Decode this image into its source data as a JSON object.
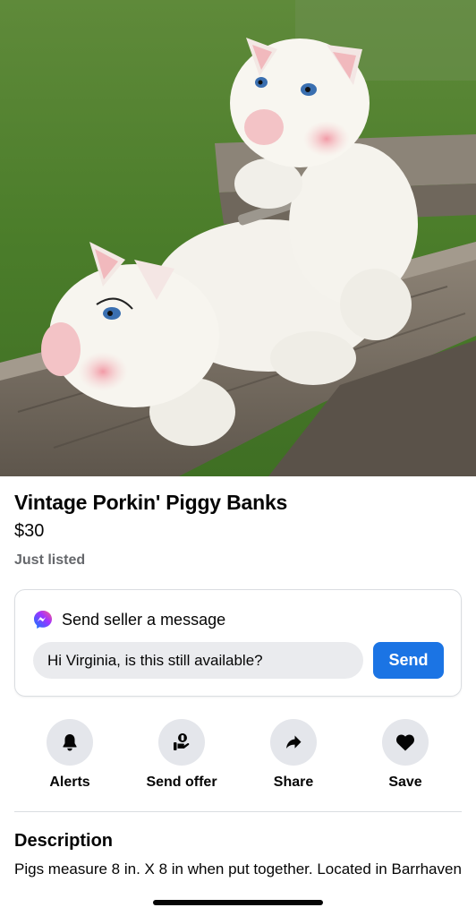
{
  "listing": {
    "photo": "two ceramic piggy banks on a wooden rail",
    "title": "Vintage Porkin' Piggy Banks",
    "price": "$30",
    "listed": "Just listed"
  },
  "message": {
    "icon": "messenger-icon",
    "heading": "Send seller a message",
    "input_value": "Hi Virginia, is this still available?",
    "send_label": "Send",
    "accent_color": "#1b74e4"
  },
  "actions": [
    {
      "label": "Alerts",
      "icon": "bell-icon"
    },
    {
      "label": "Send offer",
      "icon": "offer-icon"
    },
    {
      "label": "Share",
      "icon": "share-arrow-icon"
    },
    {
      "label": "Save",
      "icon": "heart-icon"
    }
  ],
  "description": {
    "heading": "Description",
    "text": "Pigs measure 8 in. X 8 in when put together. Located in Barrhaven"
  }
}
